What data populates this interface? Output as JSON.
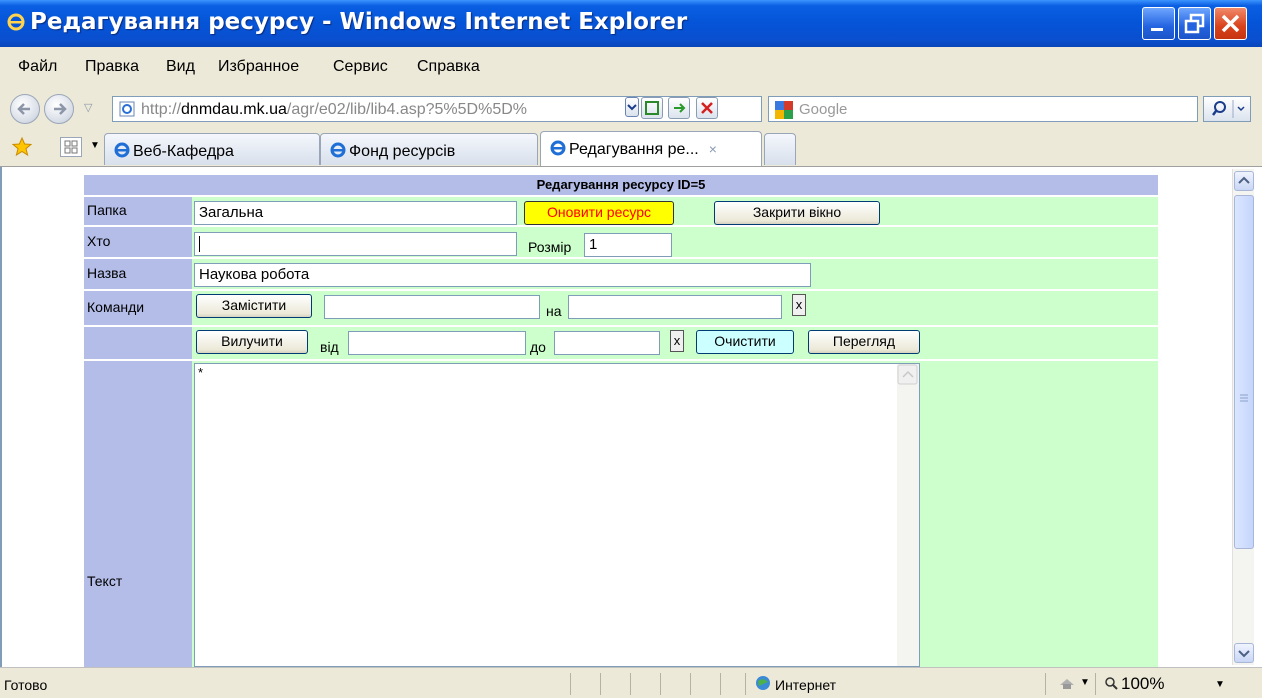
{
  "window": {
    "title": "Редагування ресурсу - Windows Internet Explorer"
  },
  "menu": [
    "Файл",
    "Правка",
    "Вид",
    "Избранное",
    "Сервис",
    "Справка"
  ],
  "address": {
    "url_prefix": "http://",
    "url_host": "dnmdau.mk.ua",
    "url_path": "/agr/e02/lib/lib4.asp?5%5D%5D%",
    "search_placeholder": "Google"
  },
  "tabs": [
    {
      "label": "Веб-Кафедра",
      "active": false
    },
    {
      "label": "Фонд ресурсів",
      "active": false
    },
    {
      "label": "Редагування ре...",
      "active": true,
      "close": "×"
    }
  ],
  "form": {
    "header": "Редагування ресурсу ID=5",
    "labels": {
      "folder": "Папка",
      "who": "Хто",
      "name": "Назва",
      "commands": "Команди",
      "text": "Текст"
    },
    "folder_value": "Загальна",
    "update_button": "Оновити ресурс",
    "close_button": "Закрити вікно",
    "who_value": "",
    "size_label": "Розмір",
    "size_value": "1",
    "name_value": "Наукова робота",
    "replace_button": "Замістити",
    "replace_from": "",
    "on_label": "на",
    "replace_to": "",
    "x_label": "x",
    "remove_button": "Вилучити",
    "from_label": "від",
    "remove_from": "",
    "to_label": "до",
    "remove_to": "",
    "clear_button": "Очистити",
    "preview_button": "Перегляд",
    "text_value": "*"
  },
  "status": {
    "left": "Готово",
    "zone": "Интернет",
    "zoom": "100%"
  }
}
